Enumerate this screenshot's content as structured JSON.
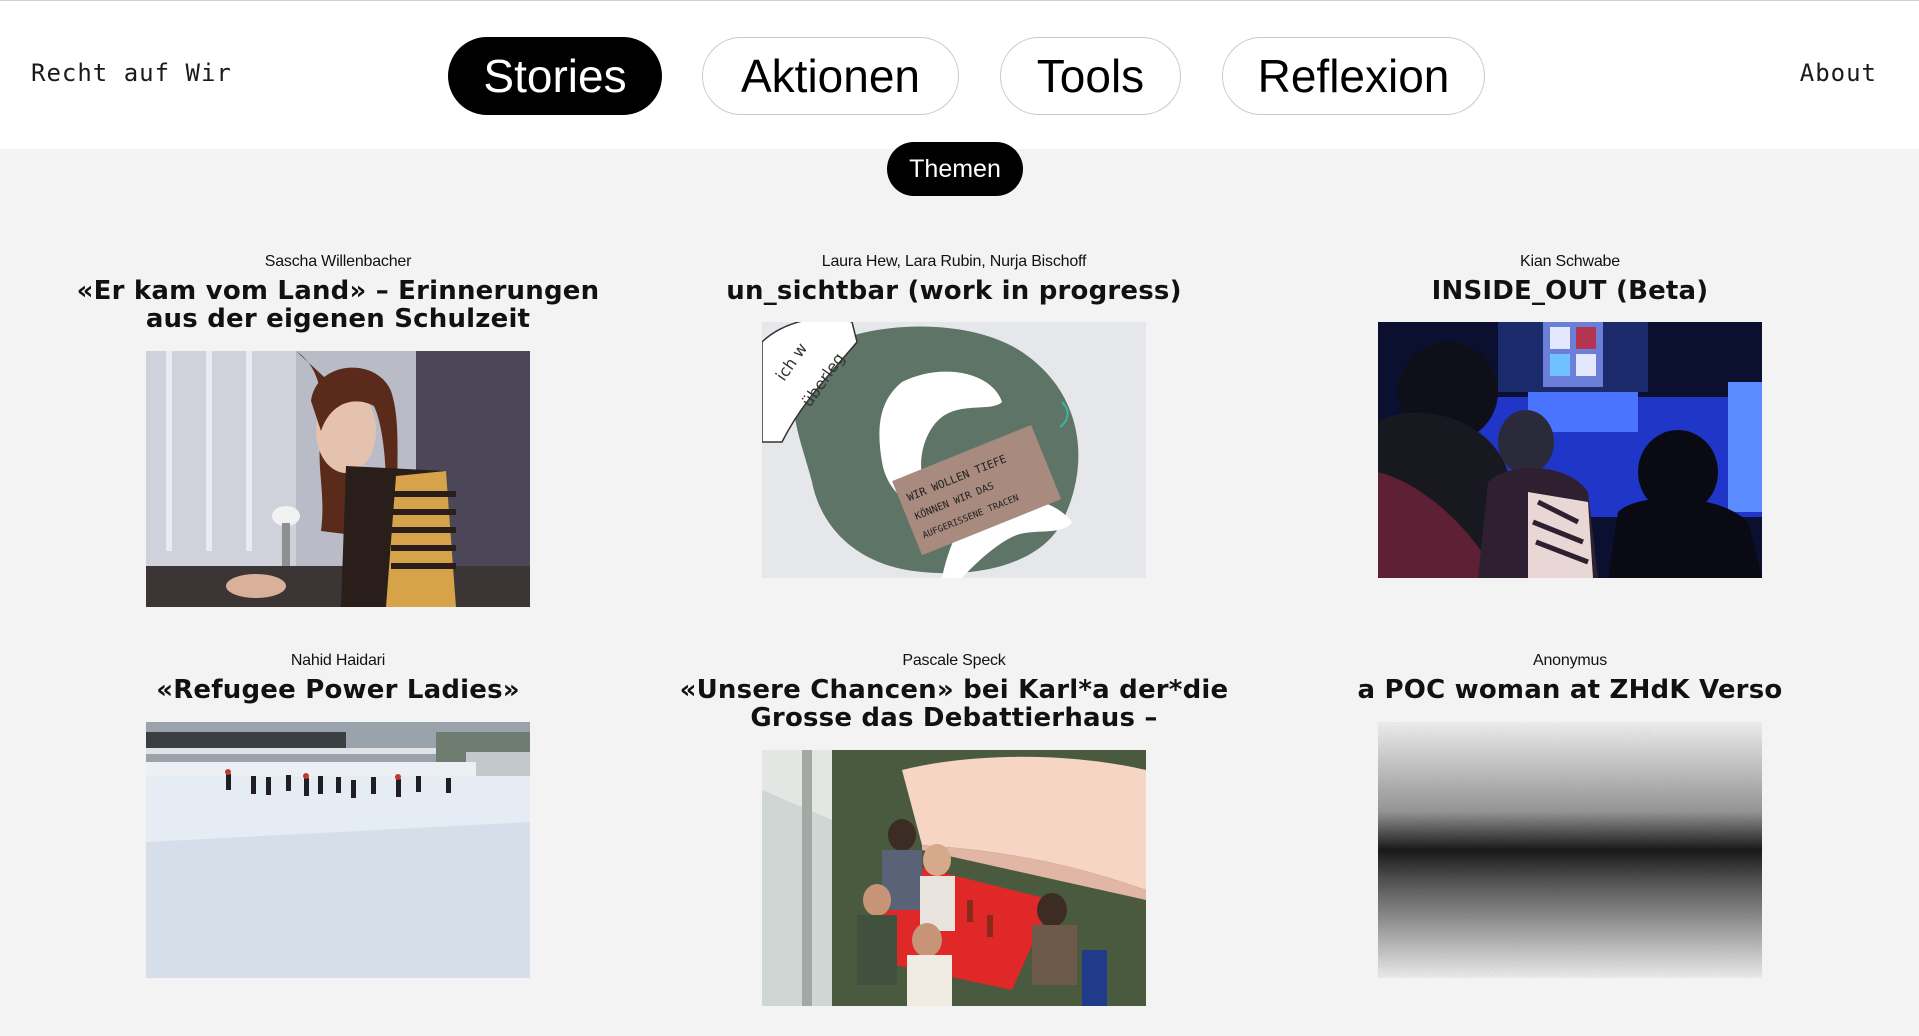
{
  "site": {
    "title": "Recht auf Wir",
    "about": "About"
  },
  "nav": [
    {
      "label": "Stories",
      "active": true
    },
    {
      "label": "Aktionen",
      "active": false
    },
    {
      "label": "Tools",
      "active": false
    },
    {
      "label": "Reflexion",
      "active": false
    }
  ],
  "filter": {
    "label": "Themen"
  },
  "cards": [
    {
      "author": "Sascha Willenbacher",
      "title": "«Er kam vom Land» – Erinnerungen aus der eigenen Schulzeit",
      "image": "vintage photo of woman in striped sweater at desk"
    },
    {
      "author": "Laura Hew, Lara Rubin, Nurja Bischoff",
      "title": "un_sichtbar (work in progress)",
      "image": "collage with handwritten notes",
      "image_text": [
        "ich w",
        "überleg",
        "WIR WOLLEN TIEFE",
        "KÖNNEN WIR DAS",
        "AUFGERISSENE TRACEN"
      ]
    },
    {
      "author": "Kian Schwabe",
      "title": "INSIDE_OUT (Beta)",
      "image": "audience watching blue-lit stage"
    },
    {
      "author": "Nahid Haidari",
      "title": "«Refugee Power Ladies»",
      "image": "people ice skating at outdoor rink"
    },
    {
      "author": "Pascale Speck",
      "title": "«Unsere Chancen» bei Karl*a der*die Grosse das Debattierhaus –",
      "image": "group sitting at red tables under umbrella"
    },
    {
      "author": "Anonymus",
      "title": "a POC woman at ZHdK Verso",
      "image": "black and white noise gradient"
    }
  ],
  "colors": {
    "accent": "#000000",
    "background": "#f3f3f3",
    "header": "#ffffff"
  }
}
